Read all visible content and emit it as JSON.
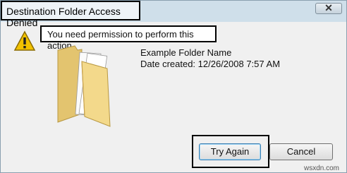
{
  "window": {
    "title": "Destination Folder Access Denied",
    "close_symbol": "✕"
  },
  "message": {
    "text": "You need permission to perform this action",
    "icon": "warning-icon"
  },
  "item": {
    "icon": "folder-icon",
    "name": "Example Folder Name",
    "date_created": "Date created: 12/26/2008 7:57 AM"
  },
  "buttons": {
    "try_again": "Try Again",
    "cancel": "Cancel"
  },
  "watermark": "wsxdn.com",
  "colors": {
    "title_bar": "#cfdfea",
    "body": "#f4f4f4",
    "highlight_border": "#000000",
    "warning": "#f2c200",
    "folder": "#f3d98b"
  }
}
